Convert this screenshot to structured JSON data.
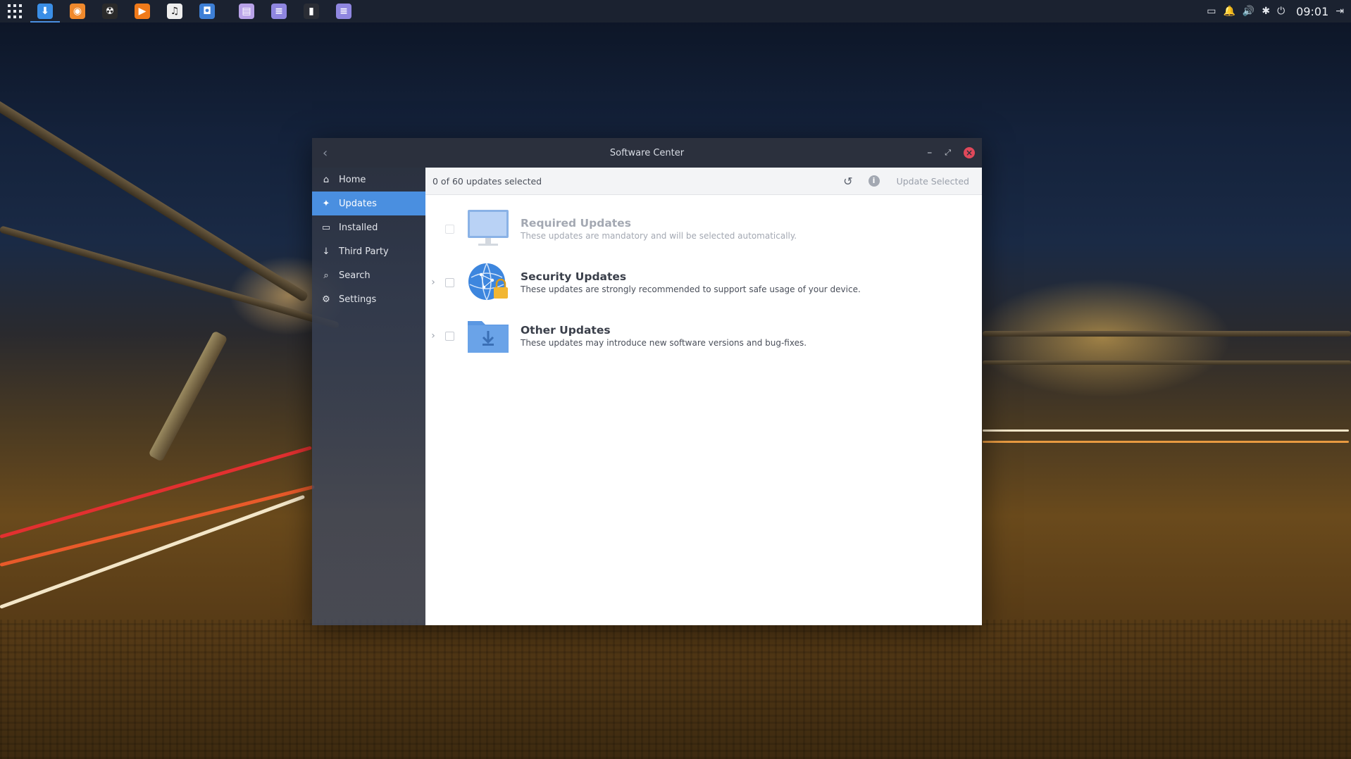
{
  "panel": {
    "launchers": [
      {
        "name": "software-center-launcher-icon",
        "glyph": "⬇",
        "color": "#3a8ee6",
        "running": true
      },
      {
        "name": "firefox-launcher-icon",
        "glyph": "◉",
        "color": "#f0892c",
        "running": false
      },
      {
        "name": "radiation-app-launcher-icon",
        "glyph": "☢",
        "color": "#2a2a2a",
        "running": false
      },
      {
        "name": "media-player-launcher-icon",
        "glyph": "▶",
        "color": "#f07a1a",
        "running": false
      },
      {
        "name": "music-launcher-icon",
        "glyph": "♫",
        "color": "#eeeeee",
        "running": false
      },
      {
        "name": "camera-launcher-icon",
        "glyph": "◘",
        "color": "#3d7fd6",
        "running": false
      },
      {
        "name": "files-launcher-icon",
        "glyph": "▤",
        "color": "#b8a2e8",
        "running": false
      },
      {
        "name": "text-editor-launcher-icon",
        "glyph": "≡",
        "color": "#8f86e0",
        "running": false
      },
      {
        "name": "terminal-launcher-icon",
        "glyph": "▮",
        "color": "#2a2d35",
        "running": false
      },
      {
        "name": "notes-launcher-icon",
        "glyph": "≡",
        "color": "#8f86e0",
        "running": false
      }
    ],
    "tray": [
      {
        "name": "display-icon",
        "glyph": "▭"
      },
      {
        "name": "notification-bell-icon",
        "glyph": "🔔"
      },
      {
        "name": "volume-icon",
        "glyph": "🔊"
      },
      {
        "name": "bluetooth-icon",
        "glyph": "✱"
      },
      {
        "name": "power-icon",
        "glyph": "⏻"
      }
    ],
    "clock": "09:01",
    "logout_icon": "logout-icon"
  },
  "window": {
    "title": "Software Center",
    "back_icon": "chevron-left-icon",
    "minimize_icon": "minimize-icon",
    "maximize_icon": "restore-icon",
    "close_icon": "close-icon"
  },
  "sidebar": {
    "items": [
      {
        "label": "Home",
        "icon": "home-icon",
        "glyph": "⌂",
        "active": false
      },
      {
        "label": "Updates",
        "icon": "gear-icon",
        "glyph": "✦",
        "active": true
      },
      {
        "label": "Installed",
        "icon": "monitor-icon",
        "glyph": "▭",
        "active": false
      },
      {
        "label": "Third Party",
        "icon": "download-arrow-icon",
        "glyph": "↓",
        "active": false
      },
      {
        "label": "Search",
        "icon": "search-icon",
        "glyph": "⌕",
        "active": false
      },
      {
        "label": "Settings",
        "icon": "settings-icon",
        "glyph": "⚙",
        "active": false
      }
    ]
  },
  "toolbar": {
    "status": "0 of 60 updates selected",
    "refresh_icon": "refresh-icon",
    "info_icon": "info-icon",
    "update_selected_label": "Update Selected"
  },
  "updates": [
    {
      "title": "Required Updates",
      "description": "These updates are mandatory and will be selected automatically.",
      "icon": "monitor-icon",
      "expandable": false,
      "disabled": true
    },
    {
      "title": "Security Updates",
      "description": "These updates are strongly recommended to support safe usage of your device.",
      "icon": "globe-lock-icon",
      "expandable": true,
      "disabled": false
    },
    {
      "title": "Other Updates",
      "description": "These updates may introduce new software versions and bug-fixes.",
      "icon": "folder-download-icon",
      "expandable": true,
      "disabled": false
    }
  ]
}
